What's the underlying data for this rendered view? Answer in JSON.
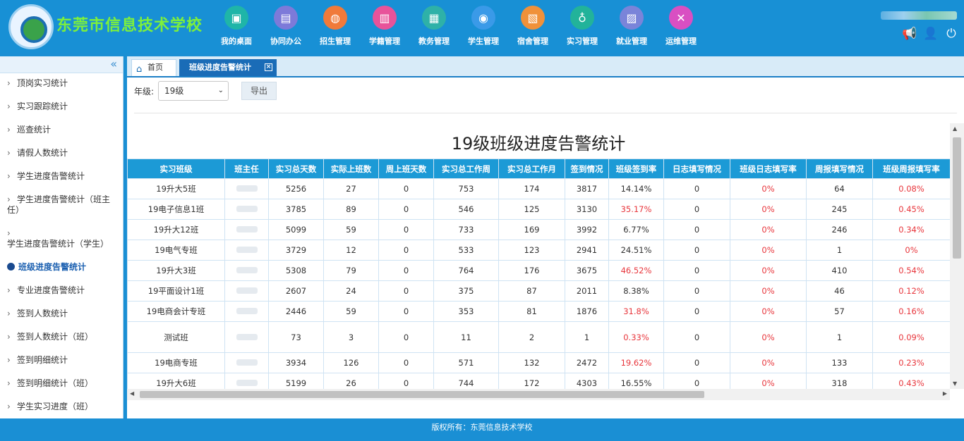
{
  "header": {
    "school_name": "东莞市信息技术学校",
    "nav": [
      {
        "label": "我的桌面",
        "color": "#1fb5a8",
        "icon": "desktop-icon"
      },
      {
        "label": "协同办公",
        "color": "#7d7ad9",
        "icon": "office-icon"
      },
      {
        "label": "招生管理",
        "color": "#f07a3a",
        "icon": "enroll-icon"
      },
      {
        "label": "学籍管理",
        "color": "#e8539a",
        "icon": "printer-icon"
      },
      {
        "label": "教务管理",
        "color": "#2eb1a8",
        "icon": "image-icon"
      },
      {
        "label": "学生管理",
        "color": "#3a9ae8",
        "icon": "student-icon"
      },
      {
        "label": "宿舍管理",
        "color": "#f0913a",
        "icon": "dorm-icon"
      },
      {
        "label": "实习管理",
        "color": "#22b39a",
        "icon": "internship-icon"
      },
      {
        "label": "就业管理",
        "color": "#7a84d9",
        "icon": "job-icon"
      },
      {
        "label": "运维管理",
        "color": "#d94fc2",
        "icon": "tools-icon"
      }
    ]
  },
  "sidebar": {
    "collapse": "«",
    "items": [
      {
        "label": "顶岗实习统计",
        "active": false
      },
      {
        "label": "实习跟踪统计",
        "active": false
      },
      {
        "label": "巡查统计",
        "active": false
      },
      {
        "label": "请假人数统计",
        "active": false
      },
      {
        "label": "学生进度告警统计",
        "active": false
      },
      {
        "label": "学生进度告警统计（班主任）",
        "active": false
      },
      {
        "label": "学生进度告警统计（学生）",
        "active": false
      },
      {
        "label": "班级进度告警统计",
        "active": true
      },
      {
        "label": "专业进度告警统计",
        "active": false
      },
      {
        "label": "签到人数统计",
        "active": false
      },
      {
        "label": "签到人数统计（班）",
        "active": false
      },
      {
        "label": "签到明细统计",
        "active": false
      },
      {
        "label": "签到明细统计（班）",
        "active": false
      },
      {
        "label": "学生实习进度（班）",
        "active": false
      }
    ]
  },
  "tabs": {
    "home": "首页",
    "active": "班级进度告警统计",
    "close": "×"
  },
  "toolbar": {
    "grade_label": "年级:",
    "grade_value": "19级",
    "export_label": "导出"
  },
  "report": {
    "title": "19级班级进度告警统计",
    "columns": [
      "实习班级",
      "班主任",
      "实习总天数",
      "实际上班数",
      "周上班天数",
      "实习总工作周",
      "实习总工作月",
      "签到情况",
      "班级签到率",
      "日志填写情况",
      "班级日志填写率",
      "周报填写情况",
      "班级周报填写率"
    ],
    "rows": [
      {
        "cls": "19升大5班",
        "days": "5256",
        "actual": "27",
        "weekdays": "0",
        "weeks": "753",
        "months": "174",
        "signin": "3817",
        "sign_rate": "14.14%",
        "sign_red": false,
        "log": "0",
        "log_rate": "0%",
        "weekly": "64",
        "weekly_rate": "0.08%",
        "weekly_red": true
      },
      {
        "cls": "19电子信息1班",
        "days": "3785",
        "actual": "89",
        "weekdays": "0",
        "weeks": "546",
        "months": "125",
        "signin": "3130",
        "sign_rate": "35.17%",
        "sign_red": true,
        "log": "0",
        "log_rate": "0%",
        "weekly": "245",
        "weekly_rate": "0.45%",
        "weekly_red": true
      },
      {
        "cls": "19升大12班",
        "days": "5099",
        "actual": "59",
        "weekdays": "0",
        "weeks": "733",
        "months": "169",
        "signin": "3992",
        "sign_rate": "6.77%",
        "sign_red": false,
        "log": "0",
        "log_rate": "0%",
        "weekly": "246",
        "weekly_rate": "0.34%",
        "weekly_red": true
      },
      {
        "cls": "19电气专班",
        "days": "3729",
        "actual": "12",
        "weekdays": "0",
        "weeks": "533",
        "months": "123",
        "signin": "2941",
        "sign_rate": "24.51%",
        "sign_red": false,
        "log": "0",
        "log_rate": "0%",
        "weekly": "1",
        "weekly_rate": "0%",
        "weekly_red": true
      },
      {
        "cls": "19升大3班",
        "days": "5308",
        "actual": "79",
        "weekdays": "0",
        "weeks": "764",
        "months": "176",
        "signin": "3675",
        "sign_rate": "46.52%",
        "sign_red": true,
        "log": "0",
        "log_rate": "0%",
        "weekly": "410",
        "weekly_rate": "0.54%",
        "weekly_red": true
      },
      {
        "cls": "19平面设计1班",
        "days": "2607",
        "actual": "24",
        "weekdays": "0",
        "weeks": "375",
        "months": "87",
        "signin": "2011",
        "sign_rate": "8.38%",
        "sign_red": false,
        "log": "0",
        "log_rate": "0%",
        "weekly": "46",
        "weekly_rate": "0.12%",
        "weekly_red": true
      },
      {
        "cls": "19电商会计专班",
        "days": "2446",
        "actual": "59",
        "weekdays": "0",
        "weeks": "353",
        "months": "81",
        "signin": "1876",
        "sign_rate": "31.8%",
        "sign_red": true,
        "log": "0",
        "log_rate": "0%",
        "weekly": "57",
        "weekly_rate": "0.16%",
        "weekly_red": true
      },
      {
        "cls": "测试班",
        "days": "73",
        "actual": "3",
        "weekdays": "0",
        "weeks": "11",
        "months": "2",
        "signin": "1",
        "sign_rate": "0.33%",
        "sign_red": true,
        "log": "0",
        "log_rate": "0%",
        "weekly": "1",
        "weekly_rate": "0.09%",
        "weekly_red": true,
        "tall": true
      },
      {
        "cls": "19电商专班",
        "days": "3934",
        "actual": "126",
        "weekdays": "0",
        "weeks": "571",
        "months": "132",
        "signin": "2472",
        "sign_rate": "19.62%",
        "sign_red": true,
        "log": "0",
        "log_rate": "0%",
        "weekly": "133",
        "weekly_rate": "0.23%",
        "weekly_red": true
      },
      {
        "cls": "19升大6班",
        "days": "5199",
        "actual": "26",
        "weekdays": "0",
        "weeks": "744",
        "months": "172",
        "signin": "4303",
        "sign_rate": "16.55%",
        "sign_red": false,
        "log": "0",
        "log_rate": "0%",
        "weekly": "318",
        "weekly_rate": "0.43%",
        "weekly_red": true
      }
    ]
  },
  "footer": {
    "copyright": "版权所有：东莞信息技术学校"
  },
  "colors": {
    "header_bg": "#1890d5",
    "table_header_bg": "#1c9ad6",
    "alert_red": "#e8363c",
    "active_tab_bg": "#1a6cb7"
  }
}
